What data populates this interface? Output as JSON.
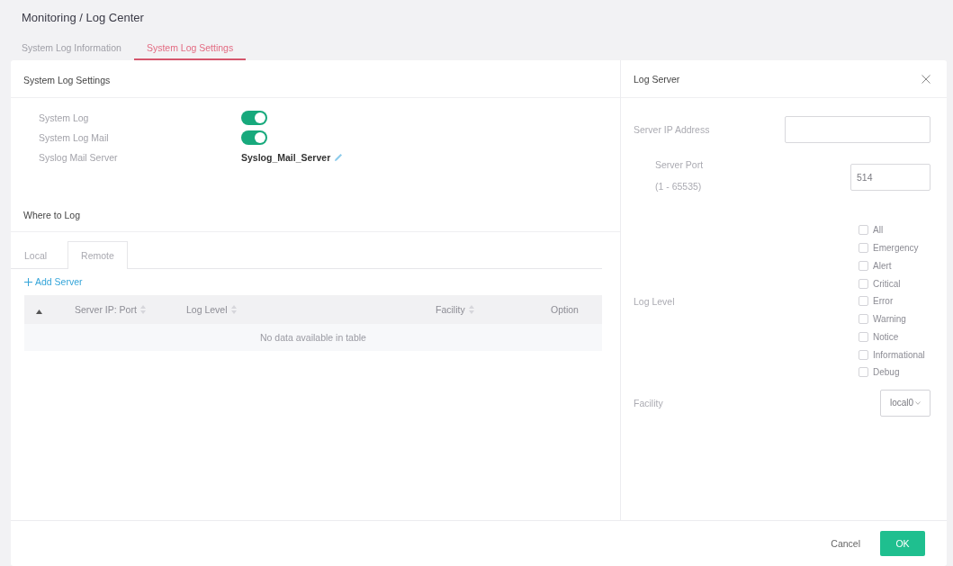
{
  "breadcrumb": "Monitoring / Log Center",
  "tabs": [
    {
      "label": "System Log Information",
      "selected": false
    },
    {
      "label": "System Log Settings",
      "selected": true
    }
  ],
  "settings_panel": {
    "title": "System Log Settings",
    "rows": [
      {
        "kind": "toggle",
        "label": "System Log",
        "on": true
      },
      {
        "kind": "toggle",
        "label": "System Log Mail",
        "on": true
      },
      {
        "kind": "link",
        "label": "Syslog Mail Server",
        "value": "Syslog_Mail_Server"
      }
    ]
  },
  "where_to_log": {
    "title": "Where to Log",
    "tabs": [
      {
        "label": "Local",
        "selected": false
      },
      {
        "label": "Remote",
        "selected": true
      }
    ],
    "add_button": "Add Server",
    "table": {
      "columns": [
        {
          "label": "Server IP: Port",
          "sortable": true
        },
        {
          "label": "Log Level",
          "sortable": true
        },
        {
          "label": "Facility",
          "sortable": true
        },
        {
          "label": "Option",
          "sortable": false
        }
      ],
      "empty_message": "No data available in table"
    }
  },
  "log_server": {
    "title": "Log Server",
    "fields": [
      {
        "kind": "text",
        "label": "Server IP Address"
      },
      {
        "kind": "number",
        "label": "Server Port",
        "hint": "(1 - 65535)",
        "value": "514"
      },
      {
        "kind": "checklist",
        "label": "Log Level",
        "options": [
          {
            "label": "All",
            "checked": false
          },
          {
            "label": "Emergency",
            "checked": false
          },
          {
            "label": "Alert",
            "checked": false
          },
          {
            "label": "Critical",
            "checked": false
          },
          {
            "label": "Error",
            "checked": false
          },
          {
            "label": "Warning",
            "checked": false
          },
          {
            "label": "Notice",
            "checked": false
          },
          {
            "label": "Informational",
            "checked": false
          },
          {
            "label": "Debug",
            "checked": false
          }
        ]
      },
      {
        "kind": "select",
        "label": "Facility",
        "value": "local0"
      }
    ]
  },
  "footer": {
    "buttons": [
      {
        "kind": "secondary",
        "label": "Cancel"
      },
      {
        "kind": "primary",
        "label": "OK"
      }
    ]
  }
}
